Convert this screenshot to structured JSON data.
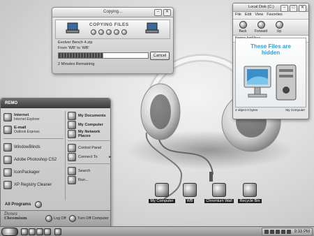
{
  "copy_dialog": {
    "title": "Copying...",
    "banner": "COPYING FILES",
    "file": "Evolver Bench 4.zip",
    "from_to": "From 'WB' to 'WB'",
    "progress_fraction": 0.5,
    "cancel": "Cancel",
    "remaining": "2 Minutes Remaining"
  },
  "explorer": {
    "title": "Local Disk (C:)",
    "menu": [
      "File",
      "Edit",
      "View",
      "Favorites"
    ],
    "toolbar": [
      "Back",
      "Forward",
      "Up"
    ],
    "norton": "Norton AntiVirus",
    "hidden_text": "These Files are hidden",
    "status_left": "4 object 0 bytes",
    "status_right": "My Computer"
  },
  "start_menu": {
    "header": "REMO",
    "pinned": [
      {
        "title": "Internet",
        "sub": "Internet Explorer"
      },
      {
        "title": "E-mail",
        "sub": "Outlook Express"
      }
    ],
    "recent": [
      "WindowBlinds",
      "Adobe Photoshop CS2",
      "IconPackager",
      "XP Registry Cleaner"
    ],
    "right": [
      "My Documents",
      "My Computer",
      "My Network Places",
      "Control Panel",
      "Connect To",
      "Search",
      "Run..."
    ],
    "all_programs": "All Programs",
    "brand_line1": "Dones",
    "brand_line2": "Chromium",
    "log_off": "Log Off",
    "turn_off": "Turn Off Computer"
  },
  "desktop_icons": [
    "My Computer",
    "WB",
    "Chromium Wall",
    "Recycle Bin"
  ],
  "taskbar": {
    "clock": "9:33 PM"
  }
}
